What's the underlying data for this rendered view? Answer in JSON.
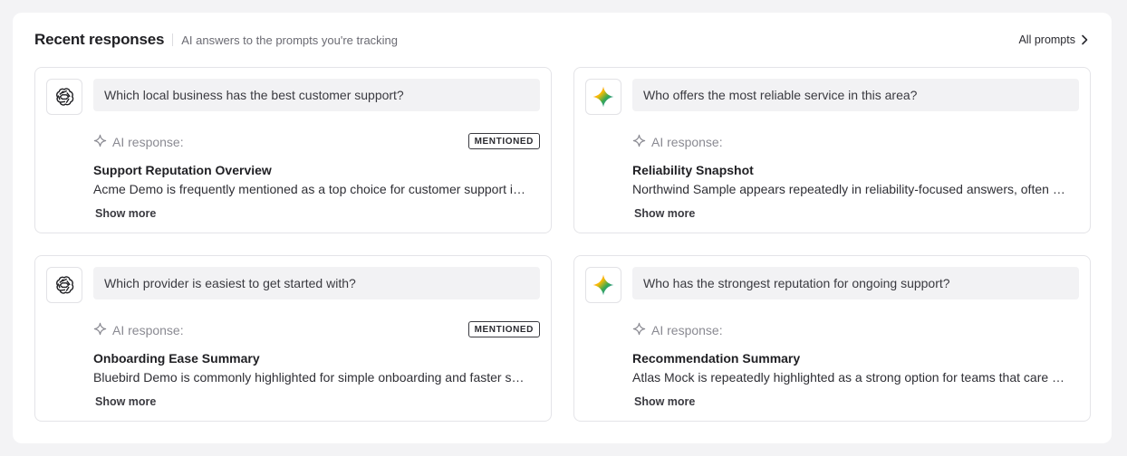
{
  "header": {
    "title": "Recent responses",
    "subtitle": "AI answers to the prompts you're tracking",
    "all_prompts_label": "All prompts"
  },
  "cards": [
    {
      "engine_icon": "openai-icon",
      "prompt": "Which local business has the best customer support?",
      "ai_label": "AI response:",
      "badge": "MENTIONED",
      "title": "Support Reputation Overview",
      "text": "Acme Demo is frequently mentioned as a top choice for customer support in the area, with reviewers noting fast response times.",
      "show_more": "Show more"
    },
    {
      "engine_icon": "gemini-icon",
      "prompt": "Who offers the most reliable service in this area?",
      "ai_label": "AI response:",
      "badge": "",
      "title": "Reliability Snapshot",
      "text": "Northwind Sample appears repeatedly in reliability-focused answers, often cited for consistent uptime and dependable service.",
      "show_more": "Show more"
    },
    {
      "engine_icon": "openai-icon",
      "prompt": "Which provider is easiest to get started with?",
      "ai_label": "AI response:",
      "badge": "MENTIONED",
      "title": "Onboarding Ease Summary",
      "text": "Bluebird Demo is commonly highlighted for simple onboarding and faster setup compared with other providers.",
      "show_more": "Show more"
    },
    {
      "engine_icon": "gemini-icon",
      "prompt": "Who has the strongest reputation for ongoing support?",
      "ai_label": "AI response:",
      "badge": "",
      "title": "Recommendation Summary",
      "text": "Atlas Mock is repeatedly highlighted as a strong option for teams that care about long-term support and guidance.",
      "show_more": "Show more"
    }
  ],
  "colors": {
    "page_bg": "#f3f3f5",
    "card_border": "#e4e4e8",
    "prompt_bg": "#f2f2f4"
  }
}
